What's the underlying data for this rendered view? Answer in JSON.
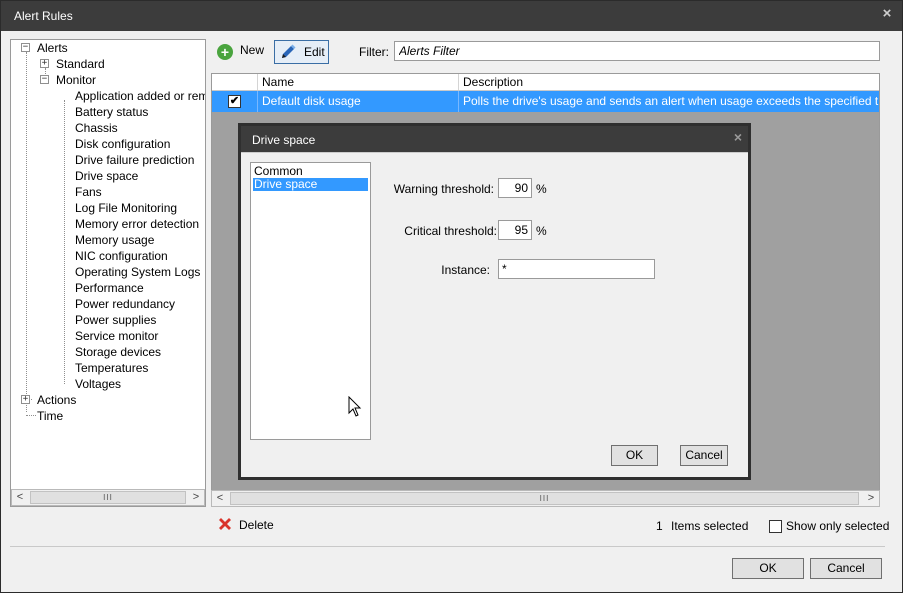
{
  "window": {
    "title": "Alert Rules",
    "close": "×"
  },
  "tree": {
    "expand_plus": "+",
    "expand_minus": "−",
    "items": [
      {
        "label": "Alerts"
      },
      {
        "label": "Standard"
      },
      {
        "label": "Monitor"
      },
      {
        "label": "Application added or remov"
      },
      {
        "label": "Battery status"
      },
      {
        "label": "Chassis"
      },
      {
        "label": "Disk configuration"
      },
      {
        "label": "Drive failure prediction"
      },
      {
        "label": "Drive space"
      },
      {
        "label": "Fans"
      },
      {
        "label": "Log File Monitoring"
      },
      {
        "label": "Memory error detection"
      },
      {
        "label": "Memory usage"
      },
      {
        "label": "NIC configuration"
      },
      {
        "label": "Operating System Logs"
      },
      {
        "label": "Performance"
      },
      {
        "label": "Power redundancy"
      },
      {
        "label": "Power supplies"
      },
      {
        "label": "Service monitor"
      },
      {
        "label": "Storage devices"
      },
      {
        "label": "Temperatures"
      },
      {
        "label": "Voltages"
      },
      {
        "label": "Actions"
      },
      {
        "label": "Time"
      }
    ]
  },
  "scroll": {
    "left": "<",
    "right": ">",
    "thumb": "III"
  },
  "toolbar": {
    "new_icon": "+",
    "new_label": "New",
    "edit_label": "Edit",
    "filter_label": "Filter:",
    "filter_value": "Alerts Filter"
  },
  "grid": {
    "columns": [
      "Name",
      "Description"
    ],
    "rows": [
      {
        "checked": "✔",
        "name": "Default disk usage",
        "description": "Polls the drive's usage and sends an alert when usage exceeds the specified thresholds."
      }
    ]
  },
  "dialog": {
    "title": "Drive space",
    "close": "×",
    "list": [
      "Common",
      "Drive space"
    ],
    "warning_label": "Warning threshold:",
    "warning_value": "90",
    "critical_label": "Critical threshold:",
    "critical_value": "95",
    "percent": "%",
    "instance_label": "Instance:",
    "instance_value": "*",
    "ok": "OK",
    "cancel": "Cancel"
  },
  "footer": {
    "delete_label": "Delete",
    "selected_count": "1",
    "items_selected": "Items selected",
    "show_only_selected": "Show only selected",
    "ok": "OK",
    "cancel": "Cancel"
  },
  "colors": {
    "selection": "#3399ff",
    "titlebar": "#3c3c3c",
    "new_green": "#4aa43e",
    "delete_red": "#d9342b"
  }
}
